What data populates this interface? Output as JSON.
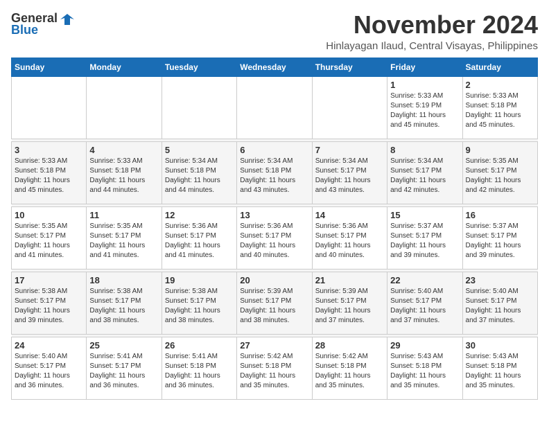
{
  "header": {
    "logo_general": "General",
    "logo_blue": "Blue",
    "month": "November 2024",
    "location": "Hinlayagan Ilaud, Central Visayas, Philippines"
  },
  "weekdays": [
    "Sunday",
    "Monday",
    "Tuesday",
    "Wednesday",
    "Thursday",
    "Friday",
    "Saturday"
  ],
  "weeks": [
    [
      {
        "day": "",
        "info": ""
      },
      {
        "day": "",
        "info": ""
      },
      {
        "day": "",
        "info": ""
      },
      {
        "day": "",
        "info": ""
      },
      {
        "day": "",
        "info": ""
      },
      {
        "day": "1",
        "info": "Sunrise: 5:33 AM\nSunset: 5:19 PM\nDaylight: 11 hours\nand 45 minutes."
      },
      {
        "day": "2",
        "info": "Sunrise: 5:33 AM\nSunset: 5:18 PM\nDaylight: 11 hours\nand 45 minutes."
      }
    ],
    [
      {
        "day": "3",
        "info": "Sunrise: 5:33 AM\nSunset: 5:18 PM\nDaylight: 11 hours\nand 45 minutes."
      },
      {
        "day": "4",
        "info": "Sunrise: 5:33 AM\nSunset: 5:18 PM\nDaylight: 11 hours\nand 44 minutes."
      },
      {
        "day": "5",
        "info": "Sunrise: 5:34 AM\nSunset: 5:18 PM\nDaylight: 11 hours\nand 44 minutes."
      },
      {
        "day": "6",
        "info": "Sunrise: 5:34 AM\nSunset: 5:18 PM\nDaylight: 11 hours\nand 43 minutes."
      },
      {
        "day": "7",
        "info": "Sunrise: 5:34 AM\nSunset: 5:17 PM\nDaylight: 11 hours\nand 43 minutes."
      },
      {
        "day": "8",
        "info": "Sunrise: 5:34 AM\nSunset: 5:17 PM\nDaylight: 11 hours\nand 42 minutes."
      },
      {
        "day": "9",
        "info": "Sunrise: 5:35 AM\nSunset: 5:17 PM\nDaylight: 11 hours\nand 42 minutes."
      }
    ],
    [
      {
        "day": "10",
        "info": "Sunrise: 5:35 AM\nSunset: 5:17 PM\nDaylight: 11 hours\nand 41 minutes."
      },
      {
        "day": "11",
        "info": "Sunrise: 5:35 AM\nSunset: 5:17 PM\nDaylight: 11 hours\nand 41 minutes."
      },
      {
        "day": "12",
        "info": "Sunrise: 5:36 AM\nSunset: 5:17 PM\nDaylight: 11 hours\nand 41 minutes."
      },
      {
        "day": "13",
        "info": "Sunrise: 5:36 AM\nSunset: 5:17 PM\nDaylight: 11 hours\nand 40 minutes."
      },
      {
        "day": "14",
        "info": "Sunrise: 5:36 AM\nSunset: 5:17 PM\nDaylight: 11 hours\nand 40 minutes."
      },
      {
        "day": "15",
        "info": "Sunrise: 5:37 AM\nSunset: 5:17 PM\nDaylight: 11 hours\nand 39 minutes."
      },
      {
        "day": "16",
        "info": "Sunrise: 5:37 AM\nSunset: 5:17 PM\nDaylight: 11 hours\nand 39 minutes."
      }
    ],
    [
      {
        "day": "17",
        "info": "Sunrise: 5:38 AM\nSunset: 5:17 PM\nDaylight: 11 hours\nand 39 minutes."
      },
      {
        "day": "18",
        "info": "Sunrise: 5:38 AM\nSunset: 5:17 PM\nDaylight: 11 hours\nand 38 minutes."
      },
      {
        "day": "19",
        "info": "Sunrise: 5:38 AM\nSunset: 5:17 PM\nDaylight: 11 hours\nand 38 minutes."
      },
      {
        "day": "20",
        "info": "Sunrise: 5:39 AM\nSunset: 5:17 PM\nDaylight: 11 hours\nand 38 minutes."
      },
      {
        "day": "21",
        "info": "Sunrise: 5:39 AM\nSunset: 5:17 PM\nDaylight: 11 hours\nand 37 minutes."
      },
      {
        "day": "22",
        "info": "Sunrise: 5:40 AM\nSunset: 5:17 PM\nDaylight: 11 hours\nand 37 minutes."
      },
      {
        "day": "23",
        "info": "Sunrise: 5:40 AM\nSunset: 5:17 PM\nDaylight: 11 hours\nand 37 minutes."
      }
    ],
    [
      {
        "day": "24",
        "info": "Sunrise: 5:40 AM\nSunset: 5:17 PM\nDaylight: 11 hours\nand 36 minutes."
      },
      {
        "day": "25",
        "info": "Sunrise: 5:41 AM\nSunset: 5:17 PM\nDaylight: 11 hours\nand 36 minutes."
      },
      {
        "day": "26",
        "info": "Sunrise: 5:41 AM\nSunset: 5:18 PM\nDaylight: 11 hours\nand 36 minutes."
      },
      {
        "day": "27",
        "info": "Sunrise: 5:42 AM\nSunset: 5:18 PM\nDaylight: 11 hours\nand 35 minutes."
      },
      {
        "day": "28",
        "info": "Sunrise: 5:42 AM\nSunset: 5:18 PM\nDaylight: 11 hours\nand 35 minutes."
      },
      {
        "day": "29",
        "info": "Sunrise: 5:43 AM\nSunset: 5:18 PM\nDaylight: 11 hours\nand 35 minutes."
      },
      {
        "day": "30",
        "info": "Sunrise: 5:43 AM\nSunset: 5:18 PM\nDaylight: 11 hours\nand 35 minutes."
      }
    ]
  ]
}
